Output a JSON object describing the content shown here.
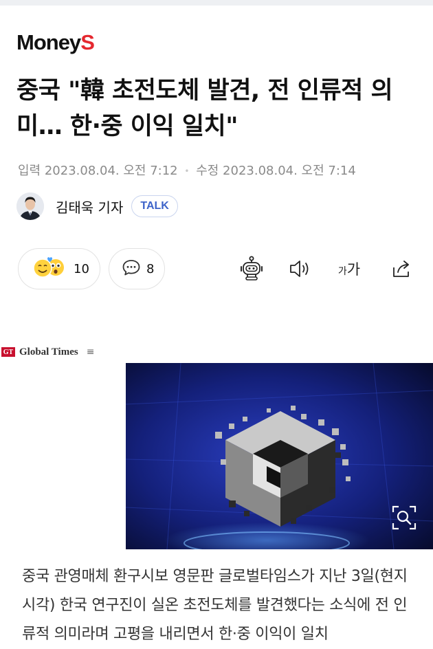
{
  "header": {
    "logo_text": "Money",
    "logo_accent": "S",
    "accent_color": "#e5282f"
  },
  "article": {
    "title": "중국 \"韓 초전도체 발견, 전 인류적 의미… 한·중 이익 일치\"",
    "published_label": "입력",
    "published": "2023.08.04. 오전 7:12",
    "modified_label": "수정",
    "modified": "2023.08.04. 오전 7:14",
    "author": "김태욱 기자",
    "talk_label": "TALK"
  },
  "actions": {
    "reaction_count": "10",
    "comment_count": "8",
    "font_size_small": "가",
    "font_size_large": "가",
    "icons": [
      "emoji-reaction-icon",
      "comment-icon",
      "robot-summary-icon",
      "speaker-icon",
      "font-size-icon",
      "share-icon"
    ]
  },
  "embed": {
    "source_badge": "GT",
    "source_name": "Global Times",
    "menu_glyph": "≡",
    "image_icon": "zoom-search-icon"
  },
  "body": {
    "paragraph": "중국 관영매체 환구시보 영문판 글로벌타임스가 지난 3일(현지시각) 한국 연구진이 실온 초전도체를 발견했다는 소식에 전 인류적 의미라며 고평을 내리면서 한·중 이익이 일치"
  }
}
